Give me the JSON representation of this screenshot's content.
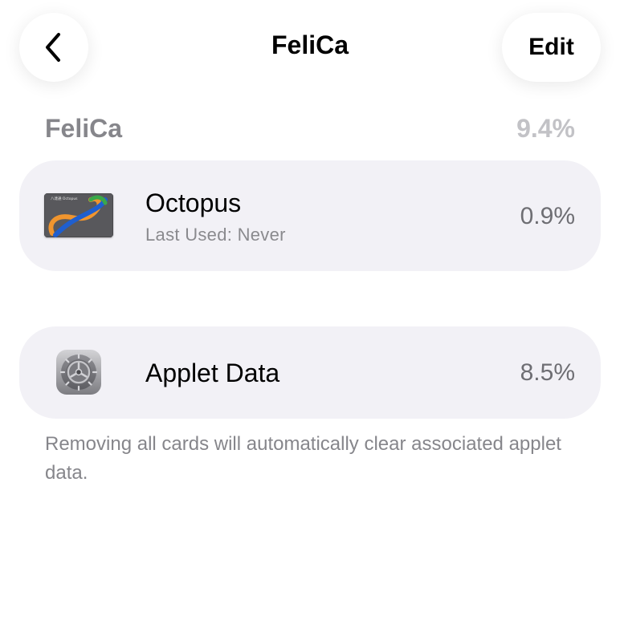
{
  "nav": {
    "title": "FeliCa",
    "back_icon": "chevron-left-icon",
    "edit_label": "Edit"
  },
  "section": {
    "title": "FeliCa",
    "total": "9.4%"
  },
  "items": [
    {
      "name": "Octopus",
      "subtitle": "Last Used: Never",
      "percent": "0.9%",
      "icon": "octopus-card-icon",
      "card_text": "八達通 Octopus"
    },
    {
      "name": "Applet Data",
      "percent": "8.5%",
      "icon": "settings-gear-icon"
    }
  ],
  "footnote": "Removing all cards will automatically clear associated applet data.",
  "colors": {
    "row_background": "#f2f1f6",
    "secondary_text": "#86868b",
    "octopus_orange": "#f0952e",
    "octopus_blue": "#1f5fcf",
    "octopus_green": "#3aa84a"
  }
}
